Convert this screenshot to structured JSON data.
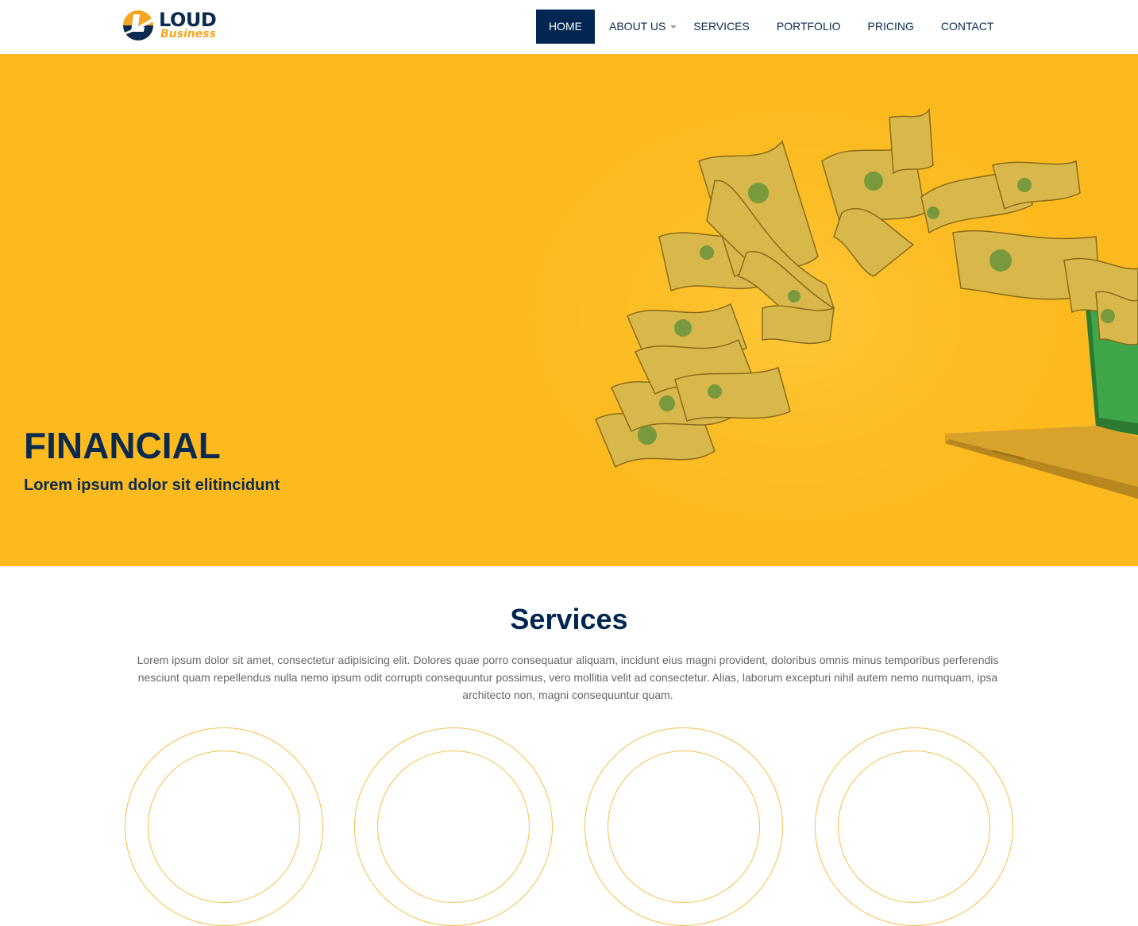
{
  "brand": {
    "name_line1": "LOUD",
    "name_line2": "Business",
    "colors": {
      "navy": "#002651",
      "gold": "#fcba1e",
      "orange": "#f5a623"
    }
  },
  "nav": {
    "items": [
      {
        "label": "HOME",
        "active": true
      },
      {
        "label": "ABOUT US",
        "dropdown": true
      },
      {
        "label": "SERVICES"
      },
      {
        "label": "PORTFOLIO"
      },
      {
        "label": "PRICING"
      },
      {
        "label": "CONTACT"
      }
    ]
  },
  "hero": {
    "title": "FINANCIAL",
    "subtitle": "Lorem ipsum dolor sit elitincidunt",
    "art": "flying-money-laptop-illustration"
  },
  "services": {
    "title": "Services",
    "description": "Lorem ipsum dolor sit amet, consectetur adipisicing elit. Dolores quae porro consequatur aliquam, incidunt eius magni provident, doloribus omnis minus temporibus perferendis nesciunt quam repellendus nulla nemo ipsum odit corrupti consequuntur possimus, vero mollitia velit ad consectetur. Alias, laborum excepturi nihil autem nemo numquam, ipsa architecto non, magni consequuntur quam."
  }
}
